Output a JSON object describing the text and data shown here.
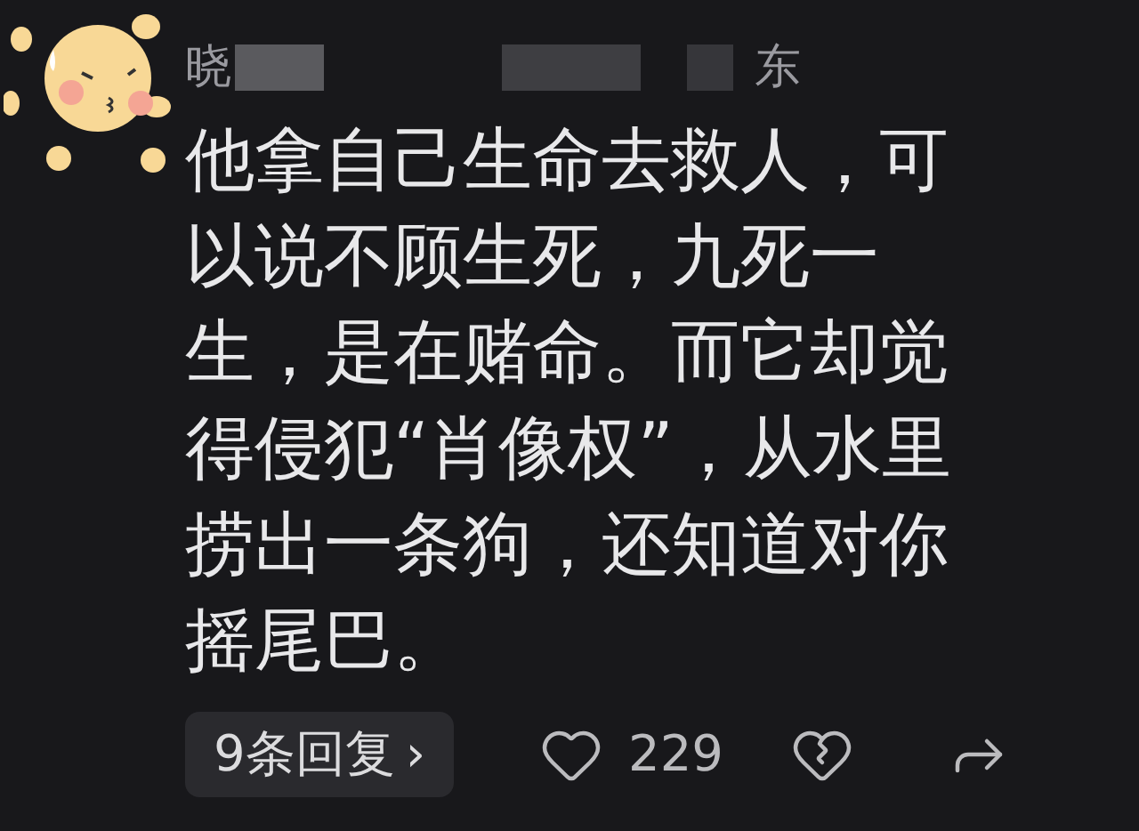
{
  "comment": {
    "author_start": "晓",
    "author_end": "东",
    "lines": [
      "他拿自己生命去救人，可",
      "以说不顾生死，九死一",
      "生，是在赌命。而它却觉",
      "得侵犯“肖像权”，从水里",
      "捞出一条狗，还知道对你",
      "摇尾巴。"
    ],
    "replies": "9条回复",
    "chevron": "›",
    "likes": "229"
  }
}
